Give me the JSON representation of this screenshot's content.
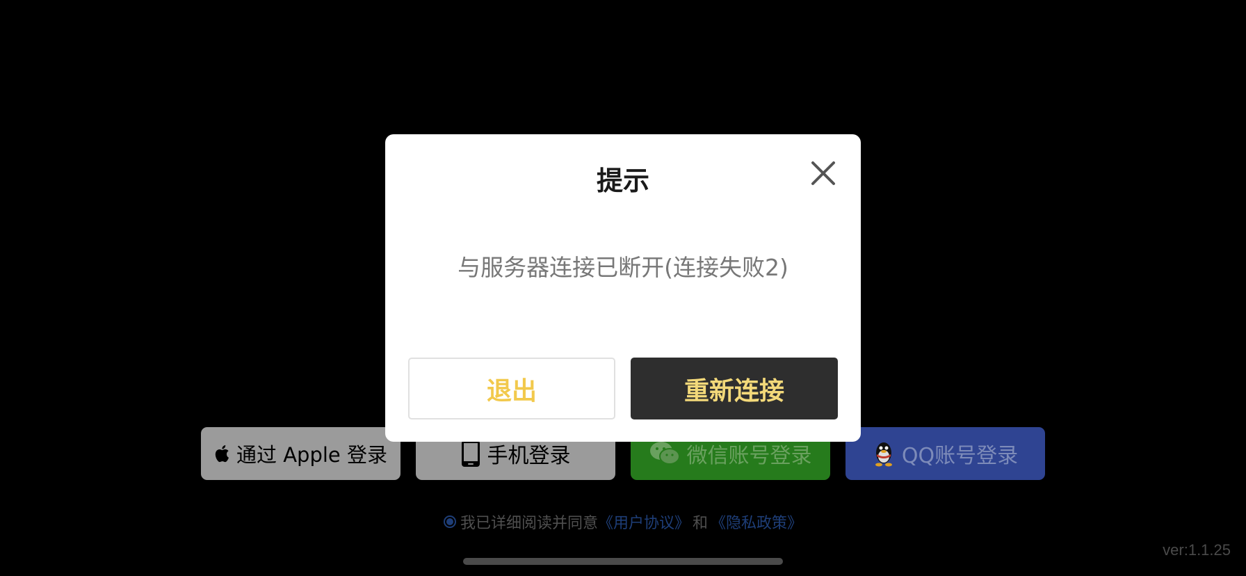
{
  "login": {
    "apple_label": "通过 Apple 登录",
    "phone_label": "手机登录",
    "wechat_label": "微信账号登录",
    "qq_label": "QQ账号登录"
  },
  "agreement": {
    "prefix": "我已详细阅读并同意",
    "user_agreement": "《用户协议》",
    "and": "和",
    "privacy_policy": "《隐私政策》"
  },
  "version": "ver:1.1.25",
  "dialog": {
    "title": "提示",
    "message": "与服务器连接已断开(连接失败2)",
    "exit_label": "退出",
    "reconnect_label": "重新连接"
  },
  "colors": {
    "exit_text": "#f2c94c",
    "reconnect_bg": "#2e2e2e",
    "reconnect_text": "#f3d97a",
    "wechat_bg": "#267b1c",
    "qq_bg": "#2f4492",
    "apple_bg": "#9b9b9b"
  }
}
